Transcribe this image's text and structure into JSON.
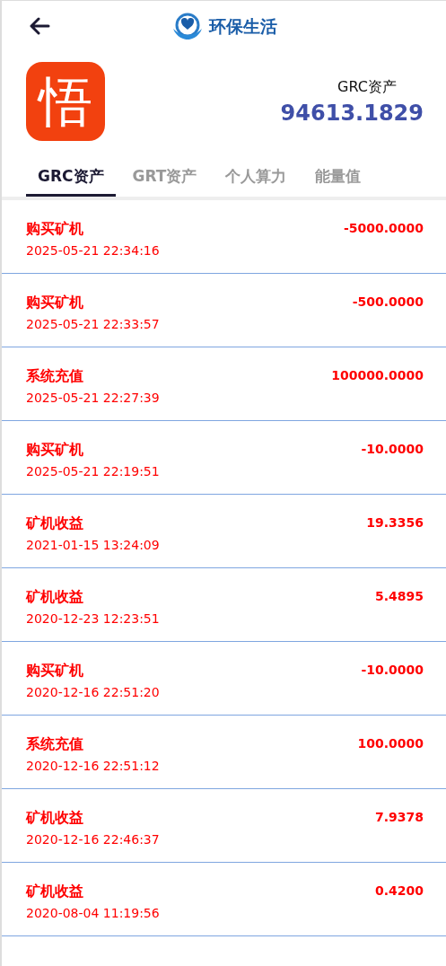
{
  "header": {
    "title": "环保生活"
  },
  "profile": {
    "avatar_text": "悟",
    "label": "GRC资产",
    "balance": "94613.1829"
  },
  "tabs": [
    {
      "label": "GRC资产",
      "selected": true
    },
    {
      "label": "GRT资产",
      "selected": false
    },
    {
      "label": "个人算力",
      "selected": false
    },
    {
      "label": "能量值",
      "selected": false
    }
  ],
  "records": [
    {
      "type": "购买矿机",
      "time": "2025-05-21 22:34:16",
      "amount": "-5000.0000"
    },
    {
      "type": "购买矿机",
      "time": "2025-05-21 22:33:57",
      "amount": "-500.0000"
    },
    {
      "type": "系统充值",
      "time": "2025-05-21 22:27:39",
      "amount": "100000.0000"
    },
    {
      "type": "购买矿机",
      "time": "2025-05-21 22:19:51",
      "amount": "-10.0000"
    },
    {
      "type": "矿机收益",
      "time": "2021-01-15 13:24:09",
      "amount": "19.3356"
    },
    {
      "type": "矿机收益",
      "time": "2020-12-23 12:23:51",
      "amount": "5.4895"
    },
    {
      "type": "购买矿机",
      "time": "2020-12-16 22:51:20",
      "amount": "-10.0000"
    },
    {
      "type": "系统充值",
      "time": "2020-12-16 22:51:12",
      "amount": "100.0000"
    },
    {
      "type": "矿机收益",
      "time": "2020-12-16 22:46:37",
      "amount": "7.9378"
    },
    {
      "type": "矿机收益",
      "time": "2020-08-04 11:19:56",
      "amount": "0.4200"
    }
  ]
}
